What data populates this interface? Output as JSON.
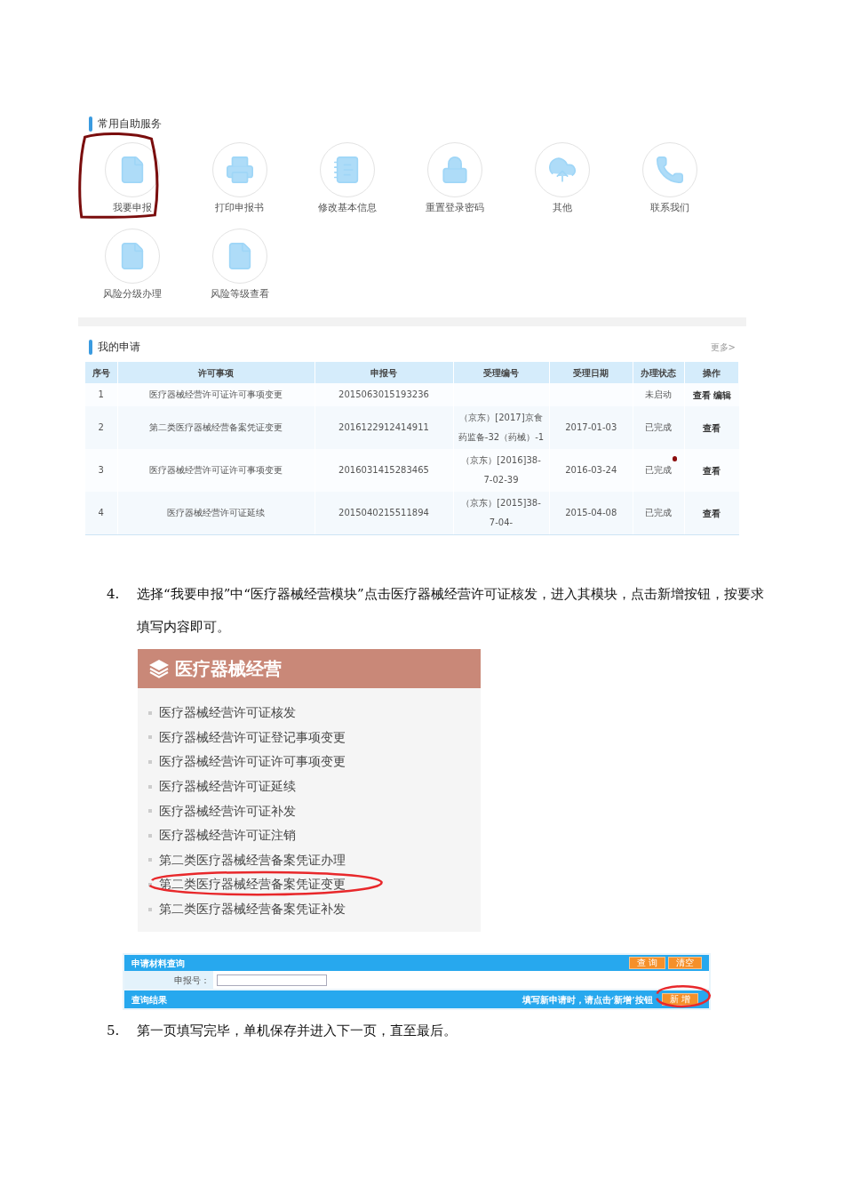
{
  "services": {
    "title": "常用自助服务",
    "items": [
      {
        "label": "我要申报",
        "circled": true
      },
      {
        "label": "打印申报书",
        "circled": false
      },
      {
        "label": "修改基本信息",
        "circled": false
      },
      {
        "label": "重置登录密码",
        "circled": false
      },
      {
        "label": "其他",
        "circled": false
      },
      {
        "label": "联系我们",
        "circled": false
      },
      {
        "label": "风险分级办理",
        "circled": false
      },
      {
        "label": "风险等级查看",
        "circled": false
      }
    ]
  },
  "applications": {
    "title": "我的申请",
    "more": "更多>",
    "columns": [
      "序号",
      "许可事项",
      "申报号",
      "受理编号",
      "受理日期",
      "办理状态",
      "操作"
    ],
    "rows": [
      {
        "cells": [
          "1",
          "医疗器械经营许可证许可事项变更",
          "2015063015193236",
          "",
          "",
          "未启动"
        ],
        "actions": [
          "查看",
          "编辑"
        ],
        "dot": false
      },
      {
        "cells": [
          "2",
          "第二类医疗器械经营备案凭证变更",
          "2016122912414911",
          "（京东）[2017]京食药监备-32（药械）-1",
          "2017-01-03",
          "已完成"
        ],
        "actions": [
          "查看"
        ],
        "dot": false
      },
      {
        "cells": [
          "3",
          "医疗器械经营许可证许可事项变更",
          "2016031415283465",
          "（京东）[2016]38-7-02-39",
          "2016-03-24",
          "已完成"
        ],
        "actions": [
          "查看"
        ],
        "dot": true
      },
      {
        "cells": [
          "4",
          "医疗器械经营许可证延续",
          "2015040215511894",
          "（京东）[2015]38-7-04-",
          "2015-04-08",
          "已完成"
        ],
        "actions": [
          "查看"
        ],
        "dot": false
      }
    ]
  },
  "step_4": {
    "number": "4.",
    "text": "选择“我要申报”中“医疗器械经营模块”点击医疗器械经营许可证核发，进入其模块，点击新增按钮，按要求填写内容即可。"
  },
  "menu": {
    "title": "医疗器械经营",
    "items": [
      {
        "label": "医疗器械经营许可证核发",
        "circled": false
      },
      {
        "label": "医疗器械经营许可证登记事项变更",
        "circled": false
      },
      {
        "label": "医疗器械经营许可证许可事项变更",
        "circled": false
      },
      {
        "label": "医疗器械经营许可证延续",
        "circled": false
      },
      {
        "label": "医疗器械经营许可证补发",
        "circled": false
      },
      {
        "label": "医疗器械经营许可证注销",
        "circled": false
      },
      {
        "label": "第二类医疗器械经营备案凭证办理",
        "circled": false
      },
      {
        "label": "第二类医疗器械经营备案凭证变更",
        "circled": true
      },
      {
        "label": "第二类医疗器械经营备案凭证补发",
        "circled": false
      }
    ]
  },
  "query": {
    "title": "申请材料查询",
    "buttons": [
      "查 询",
      "清空"
    ],
    "field_label": "申报号：",
    "results_title": "查询结果",
    "hint": "填写新申请时，请点击‘新增’按钮",
    "add_button": {
      "label": "新 增",
      "circled": true
    }
  },
  "step_5": {
    "number": "5.",
    "text": "第一页填写完毕，单机保存并进入下一页，直至最后。"
  }
}
